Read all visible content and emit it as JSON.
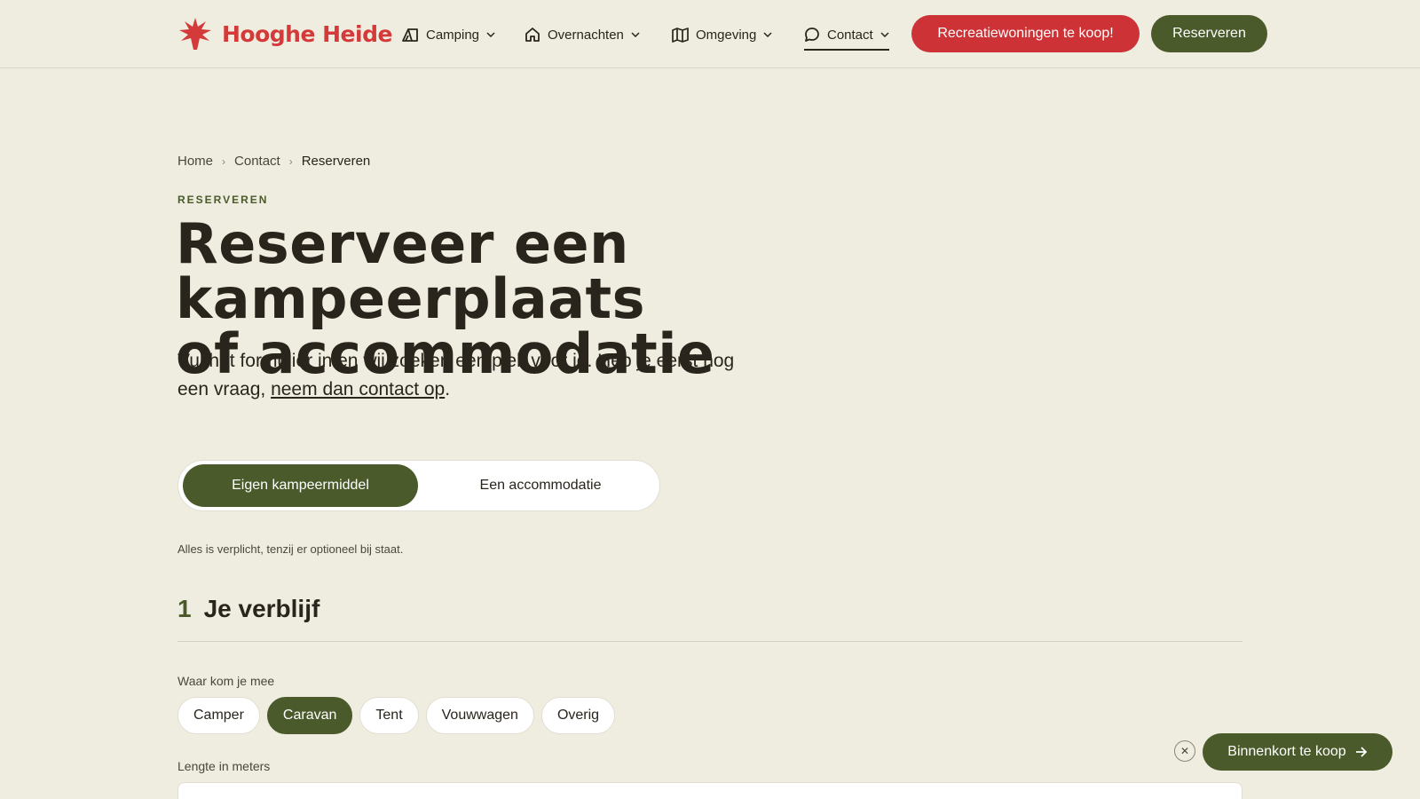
{
  "brand": {
    "name": "Hooghe Heide",
    "color": "#d43a3a"
  },
  "nav": {
    "items": [
      {
        "label": "Camping",
        "icon": "tent-icon"
      },
      {
        "label": "Overnachten",
        "icon": "home-icon"
      },
      {
        "label": "Omgeving",
        "icon": "map-icon"
      },
      {
        "label": "Contact",
        "icon": "chat-bubble-icon",
        "active": true
      }
    ],
    "cta_sale": "Recreatiewoningen te koop!",
    "cta_reserve": "Reserveren"
  },
  "breadcrumb": [
    "Home",
    "Contact",
    "Reserveren"
  ],
  "eyebrow": "RESERVEREN",
  "title_line1": "Reserveer een kampeerplaats",
  "title_line2": "of accommodatie",
  "intro": {
    "text": "Vul het formulier in en wij zoeken een plek voor je. Heb je eerst nog een vraag, ",
    "link": "neem dan contact op",
    "end": "."
  },
  "toggle": {
    "option1": "Eigen kampeermiddel",
    "option2": "Een accommodatie",
    "selected": "Eigen kampeermiddel"
  },
  "note": "Alles is verplicht, tenzij er optioneel bij staat.",
  "section": {
    "number": "1",
    "title": "Je verblijf"
  },
  "question1": {
    "label": "Waar kom je mee",
    "options": [
      "Camper",
      "Caravan",
      "Tent",
      "Vouwwagen",
      "Overig"
    ],
    "selected": "Caravan"
  },
  "question2": {
    "label": "Lengte in meters"
  },
  "floating": {
    "label": "Binnenkort te koop"
  },
  "colors": {
    "accent_green": "#4a5a2b",
    "accent_red": "#cc3236",
    "background": "#efede0"
  }
}
